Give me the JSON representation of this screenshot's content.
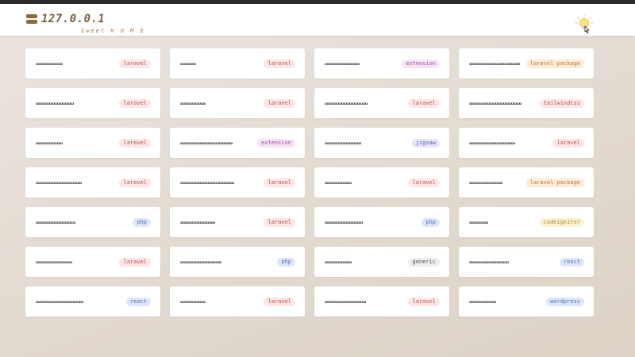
{
  "header": {
    "title": "127.0.0.1",
    "subtitle": "Sweet H O M E",
    "logo_icon": "server-icon",
    "toggle_icon": "lightbulb-icon"
  },
  "sites": [
    {
      "name": "xxxxxxxxxxxxxxxxx",
      "tag": "laravel",
      "tag_class": "laravel"
    },
    {
      "name": "xxxxxxxxxx",
      "tag": "laravel",
      "tag_class": "laravel"
    },
    {
      "name": "xxxxxxxxxxxxxxxxxxxxxx",
      "tag": "extension",
      "tag_class": "extension"
    },
    {
      "name": "xxxxxxxxxxxxxxxxxxxxxxxxxxxxxxxx",
      "tag": "laravel package",
      "tag_class": "laravel-package"
    },
    {
      "name": "xxxxxxxxxxxxxxxxxxxxxxxx",
      "tag": "laravel",
      "tag_class": "laravel"
    },
    {
      "name": "xxxxxxxxxxxxxxxx",
      "tag": "laravel",
      "tag_class": "laravel"
    },
    {
      "name": "xxxxxxxxxxxxxxxxxxxxxxxxxxx",
      "tag": "laravel",
      "tag_class": "laravel"
    },
    {
      "name": "xxxxxxxxxxxxxxxxxxxxxxxxxxxxxxxxx",
      "tag": "tailwindcss",
      "tag_class": "tailwindcss"
    },
    {
      "name": "xxxxxxxxxxxxxxxxx",
      "tag": "laravel",
      "tag_class": "laravel"
    },
    {
      "name": "xxxxxxxxxxxxxxxxxxxxxxxxxxxxxxxxx",
      "tag": "extension",
      "tag_class": "extension"
    },
    {
      "name": "xxxxxxxxxxxxxxxxxxxxxxx",
      "tag": "jigsaw",
      "tag_class": "jigsaw"
    },
    {
      "name": "xxxxxxxxxxxxxxxxxxxxxxxxxxxxx",
      "tag": "laravel",
      "tag_class": "laravel"
    },
    {
      "name": "xxxxxxxxxxxxxxxxxxxxxxxxxxxxx",
      "tag": "laravel",
      "tag_class": "laravel"
    },
    {
      "name": "xxxxxxxxxxxxxxxxxxxxxxxxxxxxxxxxxx",
      "tag": "laravel",
      "tag_class": "laravel"
    },
    {
      "name": "xxxxxxxxxxxxxxxxx",
      "tag": "laravel",
      "tag_class": "laravel"
    },
    {
      "name": "xxxxxxxxxxxxxxxxxxxxx",
      "tag": "laravel package",
      "tag_class": "laravel-package"
    },
    {
      "name": "xxxxxxxxxxxxxxxxxxxxxxxxx",
      "tag": "php",
      "tag_class": "php"
    },
    {
      "name": "xxxxxxxxxxxxxxxxxxxxxx",
      "tag": "laravel",
      "tag_class": "laravel"
    },
    {
      "name": "xxxxxxxxxxxxxxxxxxxxxxxx",
      "tag": "php",
      "tag_class": "php"
    },
    {
      "name": "xxxxxxxxxxxx",
      "tag": "codeigniter",
      "tag_class": "codeigniter"
    },
    {
      "name": "xxxxxxxxxxxxxxxxxxxxxxx",
      "tag": "laravel",
      "tag_class": "laravel"
    },
    {
      "name": "xxxxxxxxxxxxxxxxxxxxxxxxxx",
      "tag": "php",
      "tag_class": "php"
    },
    {
      "name": "xxxxxxxxxxxxxxxxx",
      "tag": "generic",
      "tag_class": "generic"
    },
    {
      "name": "xxxxxxxxxxxxxxxxxxxxxxxxx",
      "tag": "react",
      "tag_class": "react"
    },
    {
      "name": "xxxxxxxxxxxxxxxxxxxxxxxxxxxxxx",
      "tag": "react",
      "tag_class": "react"
    },
    {
      "name": "xxxxxxxxxxxxxxxx",
      "tag": "laravel",
      "tag_class": "laravel"
    },
    {
      "name": "xxxxxxxxxxxxxxxxxxxxxxxxxx",
      "tag": "laravel",
      "tag_class": "laravel"
    },
    {
      "name": "xxxxxxxxxxxxxxxxx",
      "tag": "wordpress",
      "tag_class": "wordpress"
    }
  ]
}
